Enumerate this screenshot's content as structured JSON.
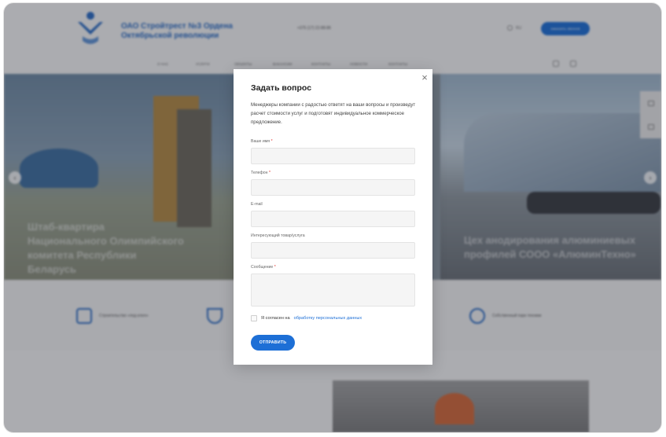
{
  "site": {
    "logo_text": "ОАО Стройтрест №3 Ордена Октябрьской революции",
    "phone": "+375 (17) 22-88-86",
    "language": "RU",
    "order_button": "ЗАКАЗАТЬ ЗВОНОК",
    "nav": [
      "О НАС",
      "УСЛУГИ",
      "ОБЪЕКТЫ",
      "ВАКАНСИИ",
      "КОНТАКТЫ",
      "НОВОСТИ",
      "КОНТАКТЫ"
    ],
    "hero_left_caption": "Штаб-квартира Национального Олимпийского комитета Республики Беларусь",
    "hero_right_caption": "Цех анодирования алюминиевых профилей СООО «АлюминТехно»",
    "features": [
      "Строительство «под ключ»",
      "Собственный парк техники"
    ]
  },
  "modal": {
    "close_label": "×",
    "title": "Задать вопрос",
    "description": "Менеджеры компании с радостью ответят на ваши вопросы и произведут расчет стоимости услуг и подготовят индивидуальное коммерческое предложение.",
    "fields": [
      {
        "label": "Ваше имя",
        "required": true
      },
      {
        "label": "Телефон",
        "required": true
      },
      {
        "label": "E-mail",
        "required": false
      },
      {
        "label": "Интересующий товар/услуга",
        "required": false
      },
      {
        "label": "Сообщение",
        "required": true
      }
    ],
    "required_mark": "*",
    "consent_text": "Я согласен на",
    "consent_link": "обработку персональных данных",
    "submit_label": "ОТПРАВИТЬ"
  },
  "colors": {
    "accent": "#1d6fd6",
    "required": "#e0322b",
    "overlay": "rgba(25,30,40,0.34)"
  }
}
